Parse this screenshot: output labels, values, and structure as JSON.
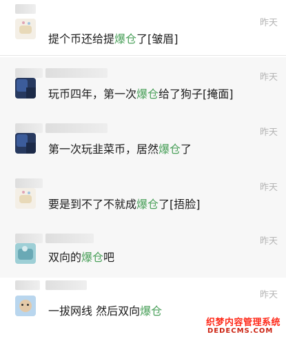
{
  "comments": [
    {
      "time": "昨天",
      "pre": "提个币还给提",
      "highlight": "爆仓",
      "post": "了[皱眉]"
    },
    {
      "time": "昨天",
      "pre": "玩币四年，第一次",
      "highlight": "爆仓",
      "post": "给了狗子[掩面]"
    },
    {
      "time": "昨天",
      "pre": "第一次玩韭菜币，居然",
      "highlight": "爆仓",
      "post": "了"
    },
    {
      "time": "昨天",
      "pre": "要是到不了不就成",
      "highlight": "爆仓",
      "post": "了[捂脸]"
    },
    {
      "time": "昨天",
      "pre": "双向的",
      "highlight": "爆仓",
      "post": "吧"
    },
    {
      "time": "昨天",
      "pre": "一拔网线 然后双向",
      "highlight": "爆仓",
      "post": ""
    }
  ],
  "colors": {
    "highlight": "#4aa05a",
    "time": "#b5b5b5",
    "row_bg": "#f7f7f7"
  },
  "watermark": {
    "line1": "织梦内容管理系统",
    "line2": "DEDECMS.COM"
  }
}
